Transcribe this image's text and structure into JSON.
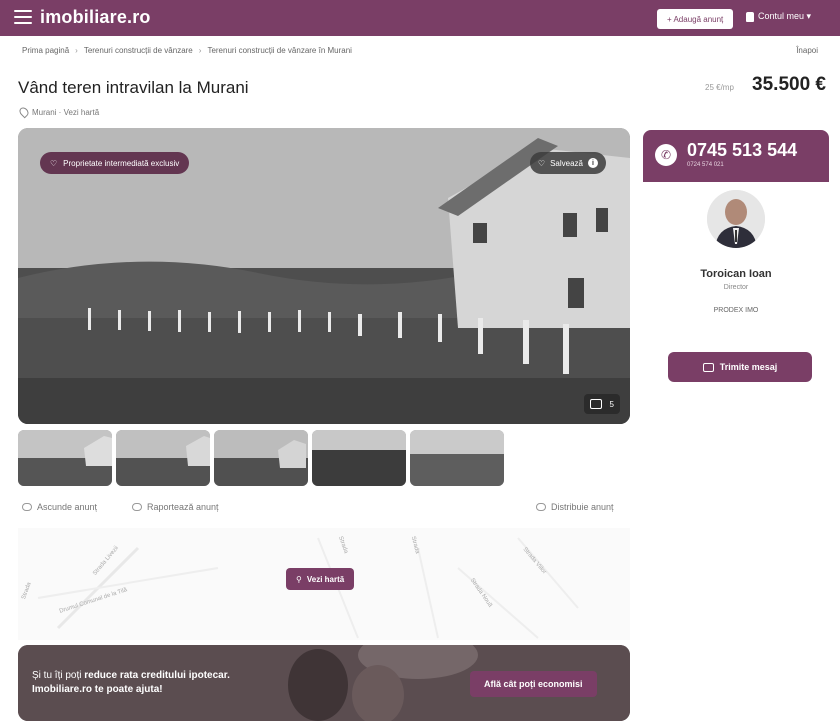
{
  "header": {
    "logo": "imobiliare.ro",
    "add_button": "+ Adaugă anunț",
    "account_label": "Contul meu ▾"
  },
  "breadcrumb": {
    "items": [
      "Prima pagină",
      "Terenuri construcții de vânzare",
      "Terenuri construcții de vânzare în Murani"
    ],
    "back": "Înapoi"
  },
  "listing": {
    "title": "Vând teren intravilan la Murani",
    "location": "Murani · Vezi hartă",
    "price_label": "25 €/mp",
    "price": "35.500 €"
  },
  "photo": {
    "badge": "Proprietate intermediată exclusiv",
    "save": "Salvează",
    "info": "i",
    "count": "5"
  },
  "actions": {
    "hide": "Ascunde anunț",
    "report": "Raportează anunț",
    "share": "Distribuie anunț"
  },
  "map": {
    "button": "Vezi hartă",
    "streets": [
      "Strada Livezii",
      "Drumul Comunal de la Tilă",
      "Strada",
      "Strada",
      "Strada Viilor",
      "Strada Nouă",
      "Strada"
    ]
  },
  "banner": {
    "line1_prefix": "Și tu îți poți ",
    "line1_bold": "reduce rata creditului ipotecar.",
    "line2": "Imobiliare.ro te poate ajuta!",
    "button": "Află cât poți economisi"
  },
  "agent": {
    "phone": "0745 513 544",
    "phone_sub": "0724 574 021",
    "name": "Toroican Ioan",
    "role": "Director",
    "agency": "PRODEX IMO",
    "message_button": "Trimite mesaj"
  },
  "colors": {
    "brand": "#7a3e66"
  }
}
